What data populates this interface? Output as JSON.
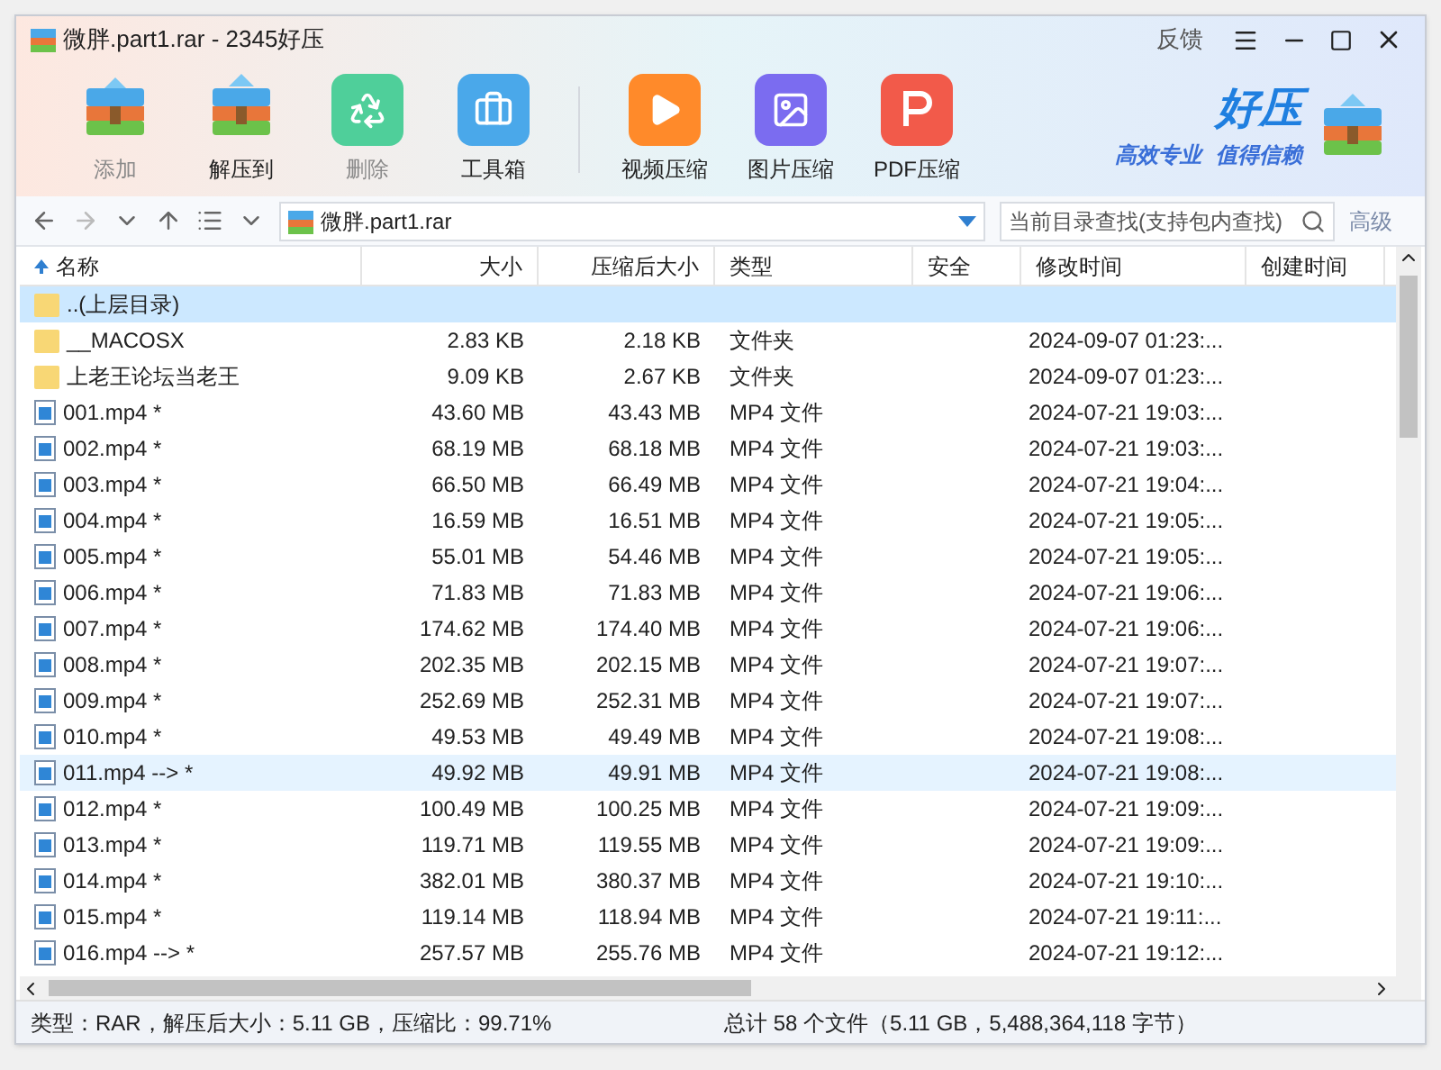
{
  "window": {
    "title": "微胖.part1.rar - 2345好压",
    "controls": [
      "反馈"
    ]
  },
  "toolbar": [
    {
      "label": "添加",
      "disabled": true,
      "kind": "add"
    },
    {
      "label": "解压到",
      "disabled": false,
      "kind": "extract"
    },
    {
      "label": "删除",
      "disabled": true,
      "kind": "delete"
    },
    {
      "label": "工具箱",
      "disabled": false,
      "kind": "tools"
    },
    {
      "label": "视频压缩",
      "disabled": false,
      "kind": "video"
    },
    {
      "label": "图片压缩",
      "disabled": false,
      "kind": "image"
    },
    {
      "label": "PDF压缩",
      "disabled": false,
      "kind": "pdf"
    }
  ],
  "brand": {
    "name": "好压",
    "slogan_1": "高效专业",
    "slogan_2": "值得信赖"
  },
  "nav": {
    "path": "微胖.part1.rar",
    "search_placeholder": "当前目录查找(支持包内查找)",
    "advanced": "高级"
  },
  "table": {
    "columns": [
      "名称",
      "大小",
      "压缩后大小",
      "类型",
      "安全",
      "修改时间",
      "创建时间"
    ],
    "rows": [
      {
        "kind": "parent",
        "name": "..(上层目录)",
        "size": "",
        "packed": "",
        "type": "",
        "modified": "",
        "selected": true,
        "hovered": false
      },
      {
        "kind": "folder",
        "name": "__MACOSX",
        "size": "2.83 KB",
        "packed": "2.18 KB",
        "type": "文件夹",
        "modified": "2024-09-07 01:23:...",
        "selected": false,
        "hovered": false
      },
      {
        "kind": "folder",
        "name": "上老王论坛当老王",
        "size": "9.09 KB",
        "packed": "2.67 KB",
        "type": "文件夹",
        "modified": "2024-09-07 01:23:...",
        "selected": false,
        "hovered": false
      },
      {
        "kind": "file",
        "name": "001.mp4 *",
        "size": "43.60 MB",
        "packed": "43.43 MB",
        "type": "MP4 文件",
        "modified": "2024-07-21 19:03:...",
        "selected": false,
        "hovered": false
      },
      {
        "kind": "file",
        "name": "002.mp4 *",
        "size": "68.19 MB",
        "packed": "68.18 MB",
        "type": "MP4 文件",
        "modified": "2024-07-21 19:03:...",
        "selected": false,
        "hovered": false
      },
      {
        "kind": "file",
        "name": "003.mp4 *",
        "size": "66.50 MB",
        "packed": "66.49 MB",
        "type": "MP4 文件",
        "modified": "2024-07-21 19:04:...",
        "selected": false,
        "hovered": false
      },
      {
        "kind": "file",
        "name": "004.mp4 *",
        "size": "16.59 MB",
        "packed": "16.51 MB",
        "type": "MP4 文件",
        "modified": "2024-07-21 19:05:...",
        "selected": false,
        "hovered": false
      },
      {
        "kind": "file",
        "name": "005.mp4 *",
        "size": "55.01 MB",
        "packed": "54.46 MB",
        "type": "MP4 文件",
        "modified": "2024-07-21 19:05:...",
        "selected": false,
        "hovered": false
      },
      {
        "kind": "file",
        "name": "006.mp4 *",
        "size": "71.83 MB",
        "packed": "71.83 MB",
        "type": "MP4 文件",
        "modified": "2024-07-21 19:06:...",
        "selected": false,
        "hovered": false
      },
      {
        "kind": "file",
        "name": "007.mp4 *",
        "size": "174.62 MB",
        "packed": "174.40 MB",
        "type": "MP4 文件",
        "modified": "2024-07-21 19:06:...",
        "selected": false,
        "hovered": false
      },
      {
        "kind": "file",
        "name": "008.mp4 *",
        "size": "202.35 MB",
        "packed": "202.15 MB",
        "type": "MP4 文件",
        "modified": "2024-07-21 19:07:...",
        "selected": false,
        "hovered": false
      },
      {
        "kind": "file",
        "name": "009.mp4 *",
        "size": "252.69 MB",
        "packed": "252.31 MB",
        "type": "MP4 文件",
        "modified": "2024-07-21 19:07:...",
        "selected": false,
        "hovered": false
      },
      {
        "kind": "file",
        "name": "010.mp4 *",
        "size": "49.53 MB",
        "packed": "49.49 MB",
        "type": "MP4 文件",
        "modified": "2024-07-21 19:08:...",
        "selected": false,
        "hovered": false
      },
      {
        "kind": "file",
        "name": "011.mp4 --> *",
        "size": "49.92 MB",
        "packed": "49.91 MB",
        "type": "MP4 文件",
        "modified": "2024-07-21 19:08:...",
        "selected": false,
        "hovered": true
      },
      {
        "kind": "file",
        "name": "012.mp4 *",
        "size": "100.49 MB",
        "packed": "100.25 MB",
        "type": "MP4 文件",
        "modified": "2024-07-21 19:09:...",
        "selected": false,
        "hovered": false
      },
      {
        "kind": "file",
        "name": "013.mp4 *",
        "size": "119.71 MB",
        "packed": "119.55 MB",
        "type": "MP4 文件",
        "modified": "2024-07-21 19:09:...",
        "selected": false,
        "hovered": false
      },
      {
        "kind": "file",
        "name": "014.mp4 *",
        "size": "382.01 MB",
        "packed": "380.37 MB",
        "type": "MP4 文件",
        "modified": "2024-07-21 19:10:...",
        "selected": false,
        "hovered": false
      },
      {
        "kind": "file",
        "name": "015.mp4 *",
        "size": "119.14 MB",
        "packed": "118.94 MB",
        "type": "MP4 文件",
        "modified": "2024-07-21 19:11:...",
        "selected": false,
        "hovered": false
      },
      {
        "kind": "file",
        "name": "016.mp4 --> *",
        "size": "257.57 MB",
        "packed": "255.76 MB",
        "type": "MP4 文件",
        "modified": "2024-07-21 19:12:...",
        "selected": false,
        "hovered": false
      }
    ]
  },
  "status_bar": {
    "left": "类型：RAR，解压后大小：5.11 GB，压缩比：99.71%",
    "right": "总计 58 个文件（5.11 GB，5,488,364,118 字节）"
  }
}
